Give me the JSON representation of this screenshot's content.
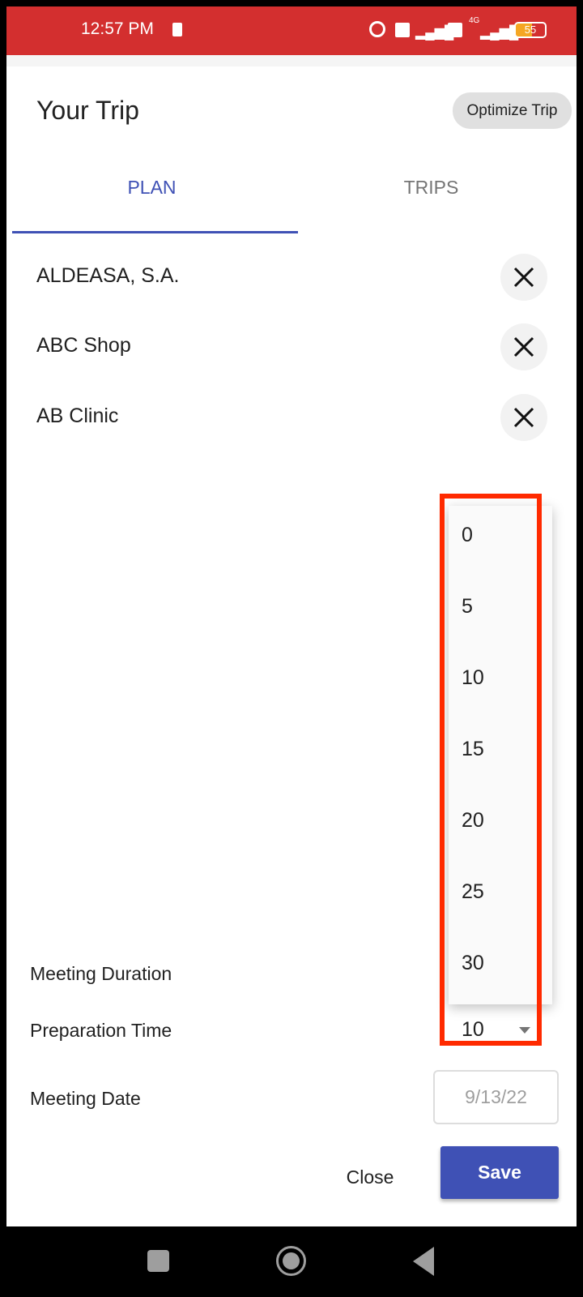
{
  "status_bar": {
    "time": "12:57 PM",
    "battery": "55",
    "network": "4G",
    "icons": [
      "battery-saver-icon",
      "alarm-icon",
      "volte-icon",
      "signal-icon",
      "volte-icon",
      "signal-4g-icon",
      "battery-icon"
    ]
  },
  "header": {
    "title": "Your Trip",
    "optimize_label": "Optimize Trip"
  },
  "tabs": [
    {
      "label": "PLAN",
      "active": true
    },
    {
      "label": "TRIPS",
      "active": false
    }
  ],
  "places": [
    {
      "name": "ALDEASA, S.A."
    },
    {
      "name": "ABC Shop"
    },
    {
      "name": "AB Clinic"
    }
  ],
  "dropdown": {
    "options": [
      "0",
      "5",
      "10",
      "15",
      "20",
      "25",
      "30"
    ]
  },
  "form": {
    "meeting_duration_label": "Meeting Duration",
    "preparation_time_label": "Preparation Time",
    "preparation_time_value": "10",
    "meeting_date_label": "Meeting Date",
    "meeting_date_value": "9/13/22"
  },
  "actions": {
    "close_label": "Close",
    "save_label": "Save"
  },
  "colors": {
    "status_bar": "#d32f2f",
    "accent": "#3f51b5",
    "highlight_box": "#ff2a00"
  }
}
